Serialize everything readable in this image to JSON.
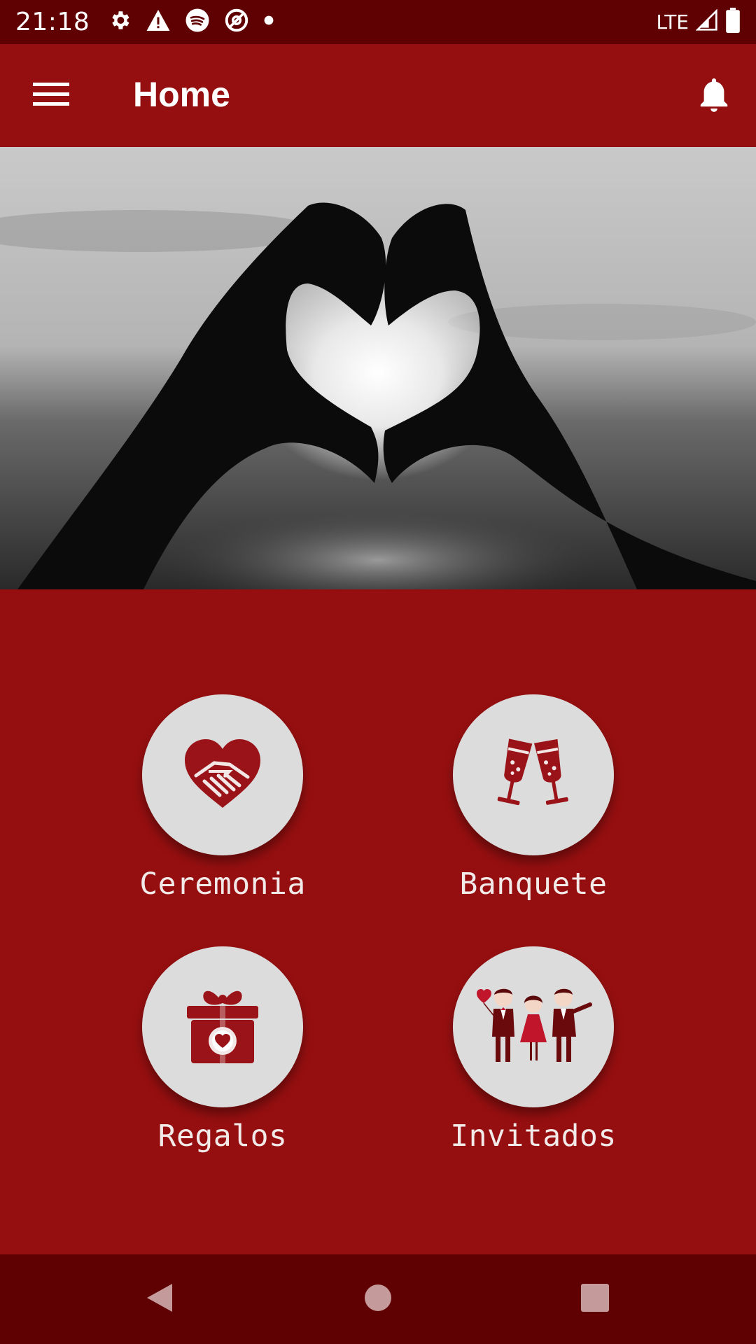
{
  "status_bar": {
    "time": "21:18",
    "network": "LTE",
    "icons": [
      "settings-icon",
      "warning-icon",
      "spotify-icon",
      "no-disturb-icon",
      "notification-dot-icon",
      "signal-icon",
      "battery-icon"
    ]
  },
  "app_bar": {
    "title": "Home",
    "menu_icon": "hamburger-menu-icon",
    "notification_icon": "bell-icon"
  },
  "hero": {
    "description_icon": "heart-hands-photo"
  },
  "menu": {
    "items": [
      {
        "label": "Ceremonia",
        "icon": "handshake-heart-icon"
      },
      {
        "label": "Banquete",
        "icon": "champagne-glasses-icon"
      },
      {
        "label": "Regalos",
        "icon": "gift-heart-icon"
      },
      {
        "label": "Invitados",
        "icon": "guests-icon"
      }
    ]
  },
  "nav_bar": {
    "back_icon": "back-triangle-icon",
    "home_icon": "home-circle-icon",
    "recents_icon": "recents-square-icon"
  },
  "colors": {
    "primary": "#950f10",
    "primary_dark": "#5f0002",
    "circle_bg": "#dcdcdc",
    "icon_red": "#9a1318"
  }
}
